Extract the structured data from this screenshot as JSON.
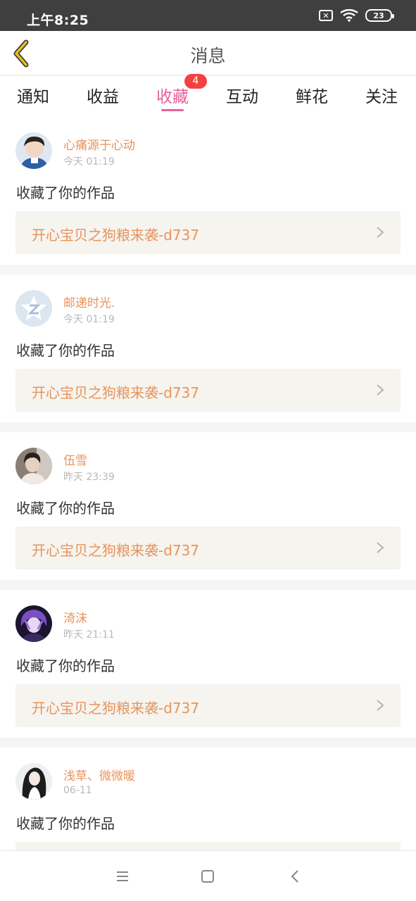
{
  "status_bar": {
    "time": "上午8:25",
    "battery": "23",
    "sim_icon": "sim-off-icon",
    "wifi_icon": "wifi-icon"
  },
  "header": {
    "title": "消息",
    "back_icon": "back-arrow-icon"
  },
  "tabs": [
    {
      "label": "通知",
      "active": false
    },
    {
      "label": "收益",
      "active": false
    },
    {
      "label": "收藏",
      "active": true,
      "badge": "4"
    },
    {
      "label": "互动",
      "active": false
    },
    {
      "label": "鲜花",
      "active": false
    },
    {
      "label": "关注",
      "active": false
    }
  ],
  "messages": [
    {
      "username": "心痛源于心动",
      "time": "今天 01:19",
      "action": "收藏了你的作品",
      "work_title": "开心宝贝之狗粮来袭-d737"
    },
    {
      "username": "邮递时光.",
      "time": "今天 01:19",
      "action": "收藏了你的作品",
      "work_title": "开心宝贝之狗粮来袭-d737"
    },
    {
      "username": "伍雪",
      "time": "昨天 23:39",
      "action": "收藏了你的作品",
      "work_title": "开心宝贝之狗粮来袭-d737"
    },
    {
      "username": "渏沫",
      "time": "昨天 21:11",
      "action": "收藏了你的作品",
      "work_title": "开心宝贝之狗粮来袭-d737"
    },
    {
      "username": "浅草、微微暖",
      "time": "06-11",
      "action": "收藏了你的作品",
      "work_title": ""
    }
  ],
  "colors": {
    "accent": "#e5619a",
    "username": "#e8935a",
    "badge": "#f4403e",
    "back_arrow": "#e8c21a"
  },
  "system_nav": {
    "menu_icon": "menu-icon",
    "home_icon": "home-square-icon",
    "back_icon": "back-triangle-icon"
  }
}
